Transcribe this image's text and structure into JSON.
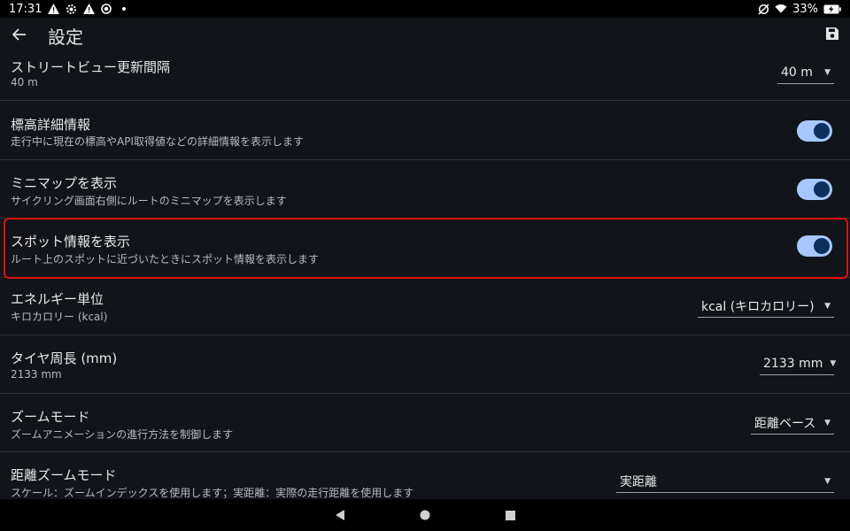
{
  "status_bar": {
    "time": "17:31",
    "battery": "33%",
    "left_icons": [
      "warning-icon",
      "gear-icon",
      "warning-icon",
      "record-icon",
      "dot-icon"
    ],
    "right_icons": [
      "no-sync-icon",
      "wifi-icon",
      "battery-charging-icon"
    ]
  },
  "app_bar": {
    "title": "設定",
    "back_icon": "arrow-left-icon",
    "save_icon": "save-icon"
  },
  "settings": [
    {
      "id": "streetview-interval",
      "title": "ストリートビュー更新間隔",
      "subtitle": "40 m",
      "control": "dropdown",
      "value": "40 m"
    },
    {
      "id": "elevation-detail",
      "title": "標高詳細情報",
      "subtitle": "走行中に現在の標高やAPI取得値などの詳細情報を表示します",
      "control": "toggle",
      "on": true
    },
    {
      "id": "minimap",
      "title": "ミニマップを表示",
      "subtitle": "サイクリング画面右側にルートのミニマップを表示します",
      "control": "toggle",
      "on": true
    },
    {
      "id": "spot-info",
      "title": "スポット情報を表示",
      "subtitle": "ルート上のスポットに近づいたときにスポット情報を表示します",
      "control": "toggle",
      "on": true
    },
    {
      "id": "energy-unit",
      "title": "エネルギー単位",
      "subtitle": "キロカロリー (kcal)",
      "control": "dropdown",
      "value": "kcal (キロカロリー)"
    },
    {
      "id": "tire-circumference",
      "title": "タイヤ周長 (mm)",
      "subtitle": "2133 mm",
      "control": "dropdown",
      "value": "2133 mm"
    },
    {
      "id": "zoom-mode",
      "title": "ズームモード",
      "subtitle": "ズームアニメーションの進行方法を制御します",
      "control": "dropdown",
      "value": "距離ベース"
    },
    {
      "id": "distance-zoom-mode",
      "title": "距離ズームモード",
      "subtitle": "スケール：ズームインデックスを使用します；実距離：実際の走行距離を使用します",
      "control": "dropdown",
      "value": "実距離"
    }
  ],
  "nav_bar": {
    "icons": [
      "nav-back-icon",
      "nav-home-icon",
      "nav-recents-icon"
    ]
  },
  "colors": {
    "background": "#111419",
    "toggle_track": "#a6c8ff",
    "toggle_knob": "#0d2f5e",
    "highlight": "#dd1111"
  }
}
